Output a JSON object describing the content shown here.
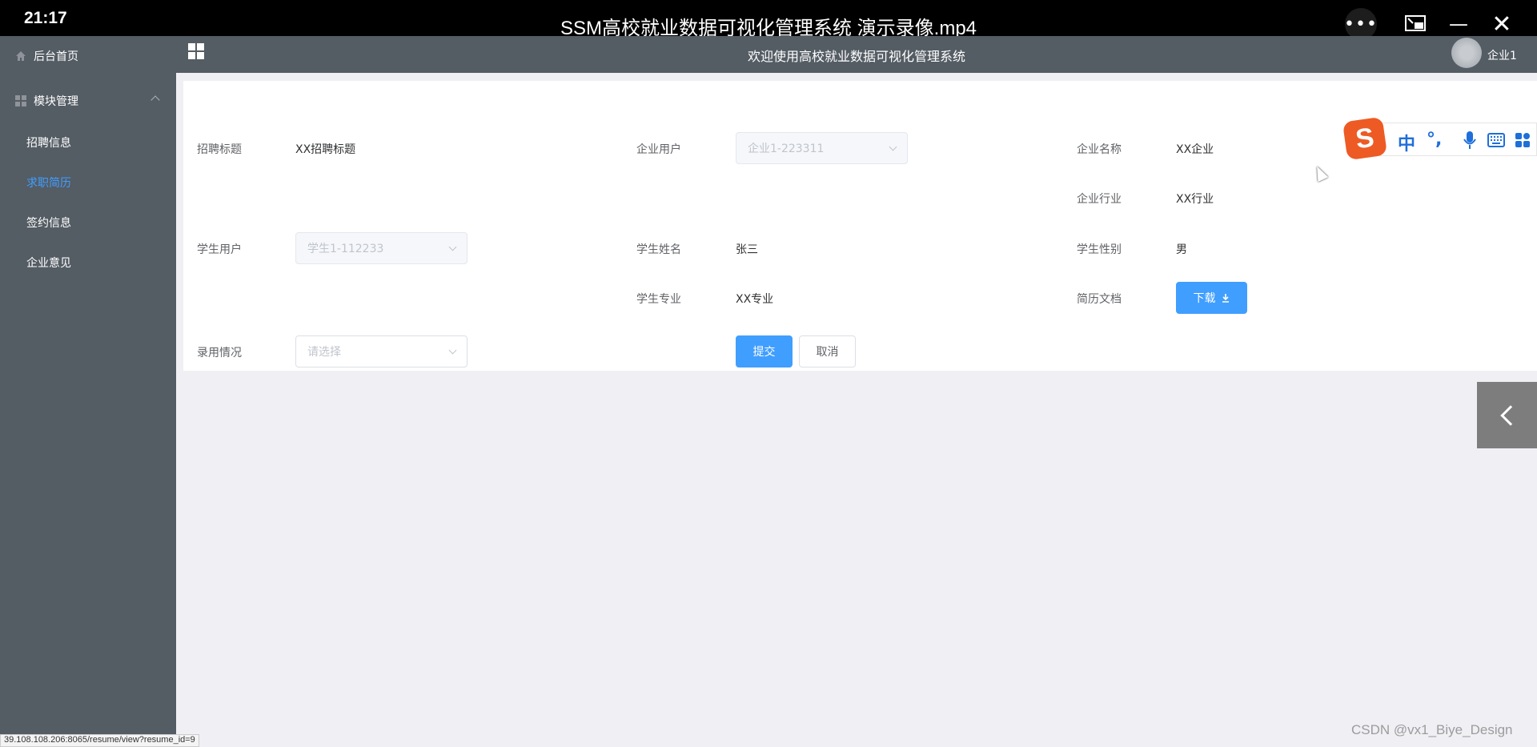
{
  "player": {
    "time": "21:17",
    "title": "SSM高校就业数据可视化管理系统 演示录像.mp4",
    "more_icon": "•••",
    "minimize_icon": "—",
    "close_icon": "✕"
  },
  "header": {
    "title": "欢迎使用高校就业数据可视化管理系统",
    "user": "企业1"
  },
  "sidebar": {
    "home": "后台首页",
    "module": "模块管理",
    "items": [
      {
        "label": "招聘信息",
        "active": false
      },
      {
        "label": "求职简历",
        "active": true
      },
      {
        "label": "签约信息",
        "active": false
      },
      {
        "label": "企业意见",
        "active": false
      }
    ]
  },
  "form": {
    "recruit_title": {
      "label": "招聘标题",
      "value": "XX招聘标题"
    },
    "company_user": {
      "label": "企业用户",
      "value": "企业1-223311"
    },
    "company_name": {
      "label": "企业名称",
      "value": "XX企业"
    },
    "company_industry": {
      "label": "企业行业",
      "value": "XX行业"
    },
    "student_user": {
      "label": "学生用户",
      "value": "学生1-112233"
    },
    "student_name": {
      "label": "学生姓名",
      "value": "张三"
    },
    "student_gender": {
      "label": "学生性别",
      "value": "男"
    },
    "student_major": {
      "label": "学生专业",
      "value": "XX专业"
    },
    "resume_doc": {
      "label": "简历文档",
      "button": "下载"
    },
    "hire_status": {
      "label": "录用情况",
      "placeholder": "请选择"
    },
    "submit": "提交",
    "cancel": "取消"
  },
  "ime": {
    "logo": "S",
    "items": [
      "中",
      "°,"
    ]
  },
  "status_url": "39.108.108.206:8065/resume/view?resume_id=9",
  "watermark": "CSDN @vx1_Biye_Design",
  "colors": {
    "sidebar_bg": "#545c64",
    "primary": "#409eff",
    "page_bg": "#f0eff4"
  }
}
